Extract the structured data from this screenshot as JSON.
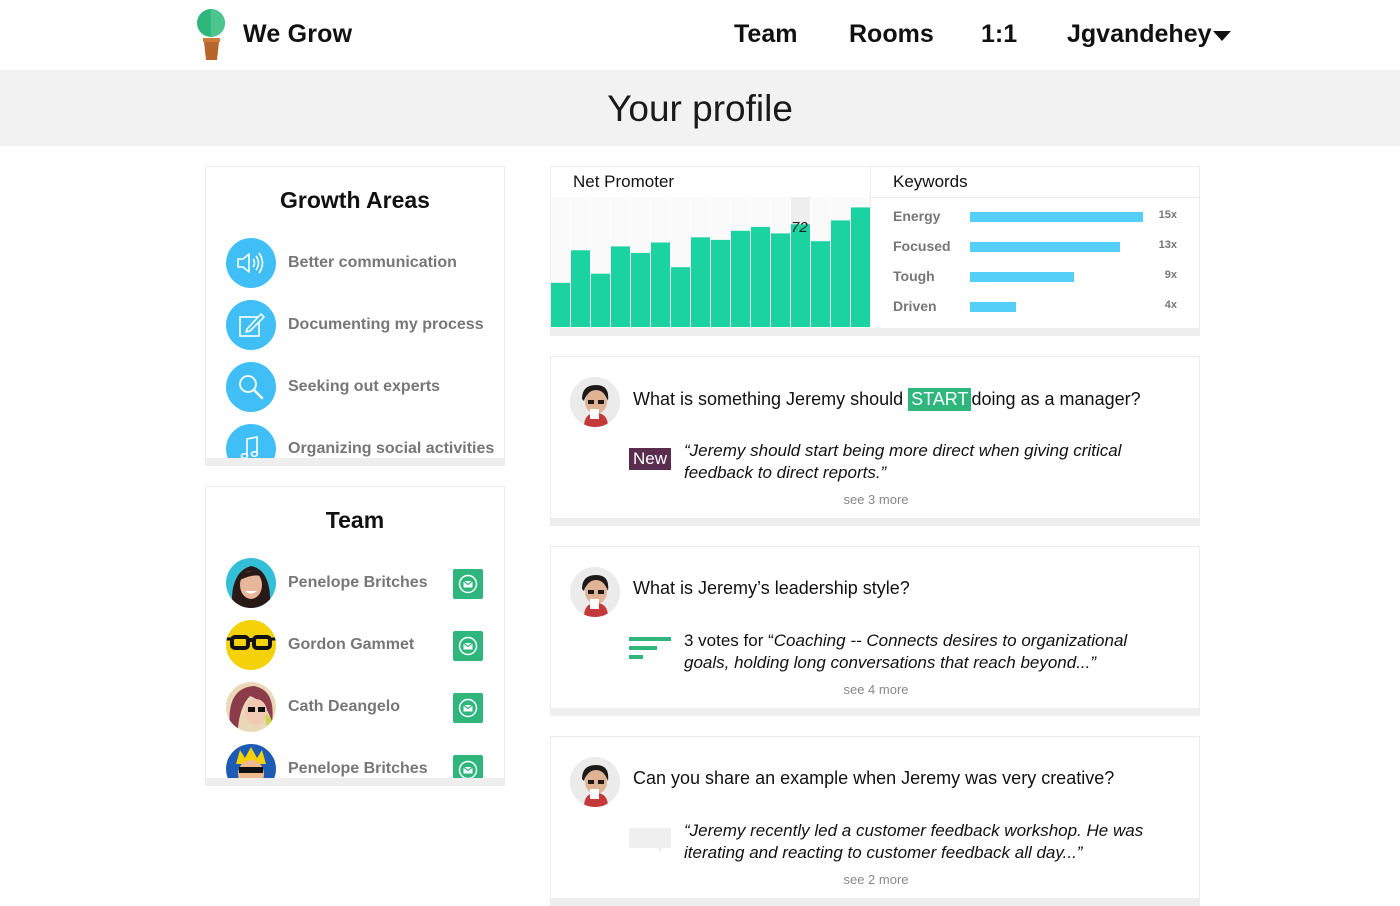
{
  "header": {
    "brand": "We Grow",
    "nav": [
      "Team",
      "Rooms",
      "1:1"
    ],
    "user": "Jgvandehey"
  },
  "page": {
    "title": "Your profile"
  },
  "growth": {
    "title": "Growth Areas",
    "items": [
      {
        "label": "Better communication",
        "icon": "speaker-icon"
      },
      {
        "label": "Documenting my process",
        "icon": "edit-icon"
      },
      {
        "label": "Seeking out experts",
        "icon": "search-icon"
      },
      {
        "label": "Organizing social activities",
        "icon": "music-note-icon"
      }
    ]
  },
  "team": {
    "title": "Team",
    "members": [
      {
        "name": "Penelope Britches"
      },
      {
        "name": "Gordon Gammet"
      },
      {
        "name": "Cath Deangelo"
      },
      {
        "name": "Penelope Britches"
      }
    ]
  },
  "net_promoter": {
    "title": "Net Promoter",
    "highlight_label": "72"
  },
  "keywords": {
    "title": "Keywords",
    "items": [
      {
        "label": "Energy",
        "count": "15x",
        "value": 15
      },
      {
        "label": "Focused",
        "count": "13x",
        "value": 13
      },
      {
        "label": "Tough",
        "count": "9x",
        "value": 9
      },
      {
        "label": "Driven",
        "count": "4x",
        "value": 4
      }
    ]
  },
  "chart_data": {
    "type": "bar",
    "title": "Net Promoter",
    "values": [
      34,
      59,
      41,
      62,
      57,
      65,
      46,
      69,
      67,
      74,
      77,
      72,
      79,
      66,
      82,
      92
    ],
    "highlight_index": 12,
    "highlight_label": "72",
    "ylim": [
      0,
      100
    ],
    "color": "#1ad3a1"
  },
  "questions": [
    {
      "prefix": "What is something Jeremy should",
      "tag": "START",
      "suffix": "doing as a manager?",
      "badge": "New",
      "quote": "“Jeremy should start being more direct when giving critical feedback to direct reports.”",
      "more": "see 3 more"
    },
    {
      "text": "What is Jeremy’s leadership style?",
      "votes": "3 votes for “",
      "quote": "Coaching -- Connects desires to organizational goals, holding long conversations that reach beyond...”",
      "more": "see 4 more"
    },
    {
      "text": "Can you share an example when Jeremy was very creative?",
      "quote": "“Jeremy recently led a customer feedback workshop. He was iterating and reacting to customer feedback all day...”",
      "more": "see 2 more"
    }
  ],
  "colors": {
    "accent_green": "#2eb67d",
    "chart_teal": "#1ad3a1",
    "keyword_blue": "#55cff7",
    "icon_blue": "#3fbff6",
    "new_badge": "#5a2d4f"
  }
}
